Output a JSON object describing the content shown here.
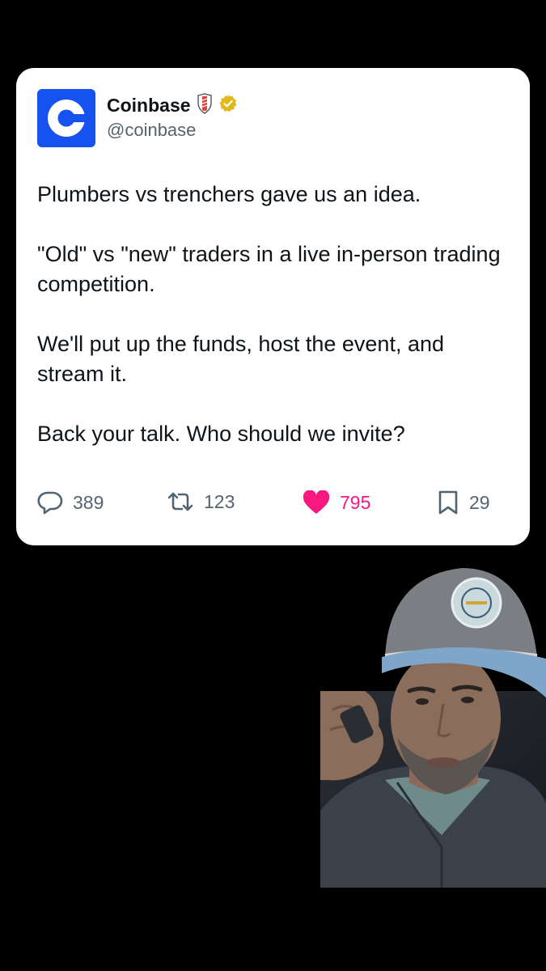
{
  "tweet": {
    "author_name": "Coinbase",
    "handle": "@coinbase",
    "paragraphs": [
      "Plumbers vs trenchers gave us an idea.",
      "\"Old\" vs \"new\" traders in a live in-person trading competition.",
      "We'll put up the funds, host the event, and stream it.",
      "Back your talk. Who should we invite?"
    ],
    "stats": {
      "replies": "389",
      "reposts": "123",
      "likes": "795",
      "bookmarks": "29"
    }
  },
  "icons": {
    "avatar": "coinbase-logo",
    "badge_affiliate": "shield-badge-icon",
    "badge_verified": "gold-verified-icon",
    "reply": "reply-icon",
    "repost": "repost-icon",
    "like": "heart-icon",
    "bookmark": "bookmark-icon"
  },
  "colors": {
    "brand_blue": "#1652f0",
    "like_pink": "#f91880",
    "verified_gold": "#e2b719",
    "secondary_text": "#536471"
  }
}
